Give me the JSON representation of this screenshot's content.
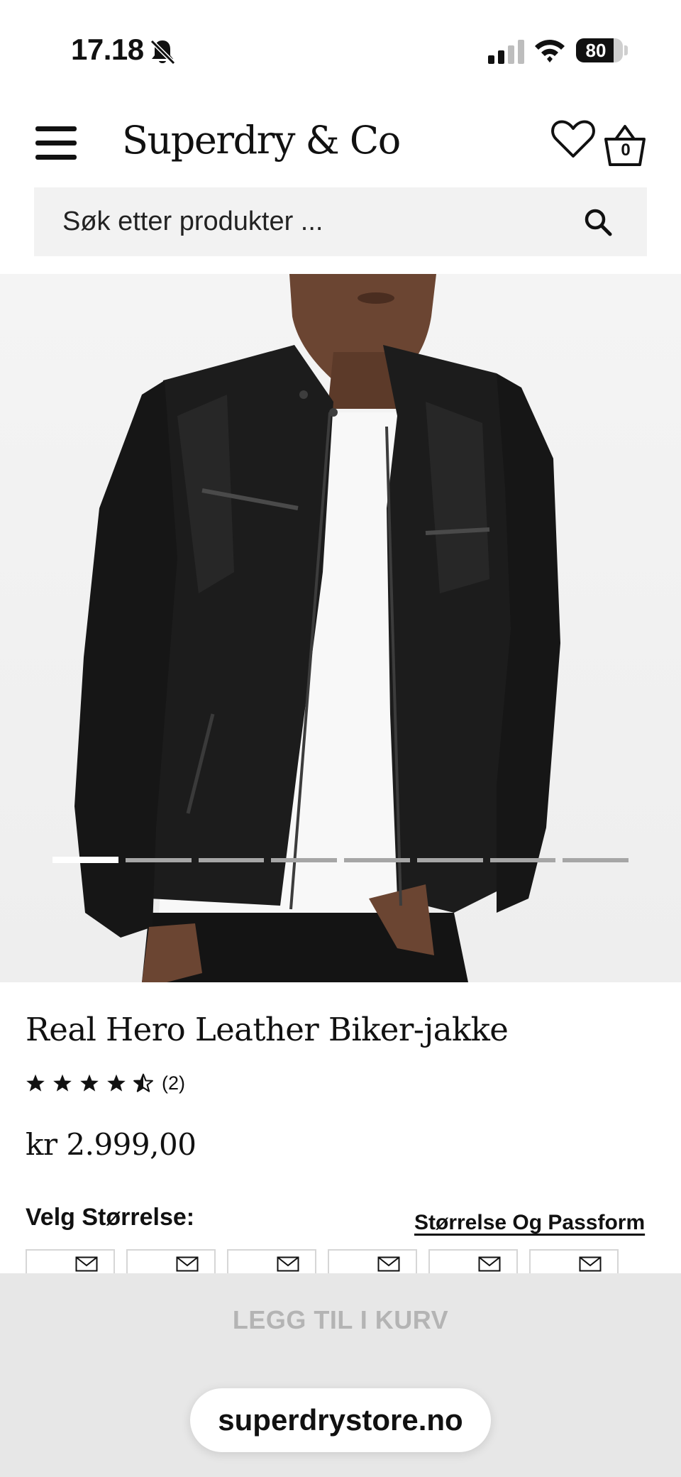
{
  "status_bar": {
    "time": "17.18",
    "battery": "80",
    "battery_level": 0.8,
    "icons": [
      "bell-off-icon",
      "signal-icon",
      "wifi-icon",
      "battery-icon"
    ]
  },
  "header": {
    "brand": "Superdry & Co",
    "basket_count": "0",
    "icons": [
      "menu-icon",
      "heart-icon",
      "basket-icon"
    ]
  },
  "search": {
    "placeholder": "Søk etter produkter ...",
    "icon": "search-icon"
  },
  "carousel": {
    "image_count": 8,
    "active_index": 0
  },
  "product": {
    "title": "Real Hero Leather Biker-jakke",
    "rating": 4.5,
    "rating_max": 5,
    "rating_count": "(2)",
    "price": "kr 2.999,00"
  },
  "size": {
    "label": "Velg Størrelse:",
    "guide_link": "Størrelse Og Passform",
    "option_count": 6,
    "option_icon": "mail-icon"
  },
  "cart": {
    "button_label": "LEGG TIL I KURV"
  },
  "browser": {
    "url": "superdrystore.no"
  },
  "colors": {
    "text": "#111111",
    "search_bg": "#f2f2f2",
    "cart_panel_bg": "#e7e7e7",
    "cart_label_disabled": "#b4b4b4",
    "carousel_active": "#ffffff",
    "carousel_inactive": "#a6a6a6"
  }
}
